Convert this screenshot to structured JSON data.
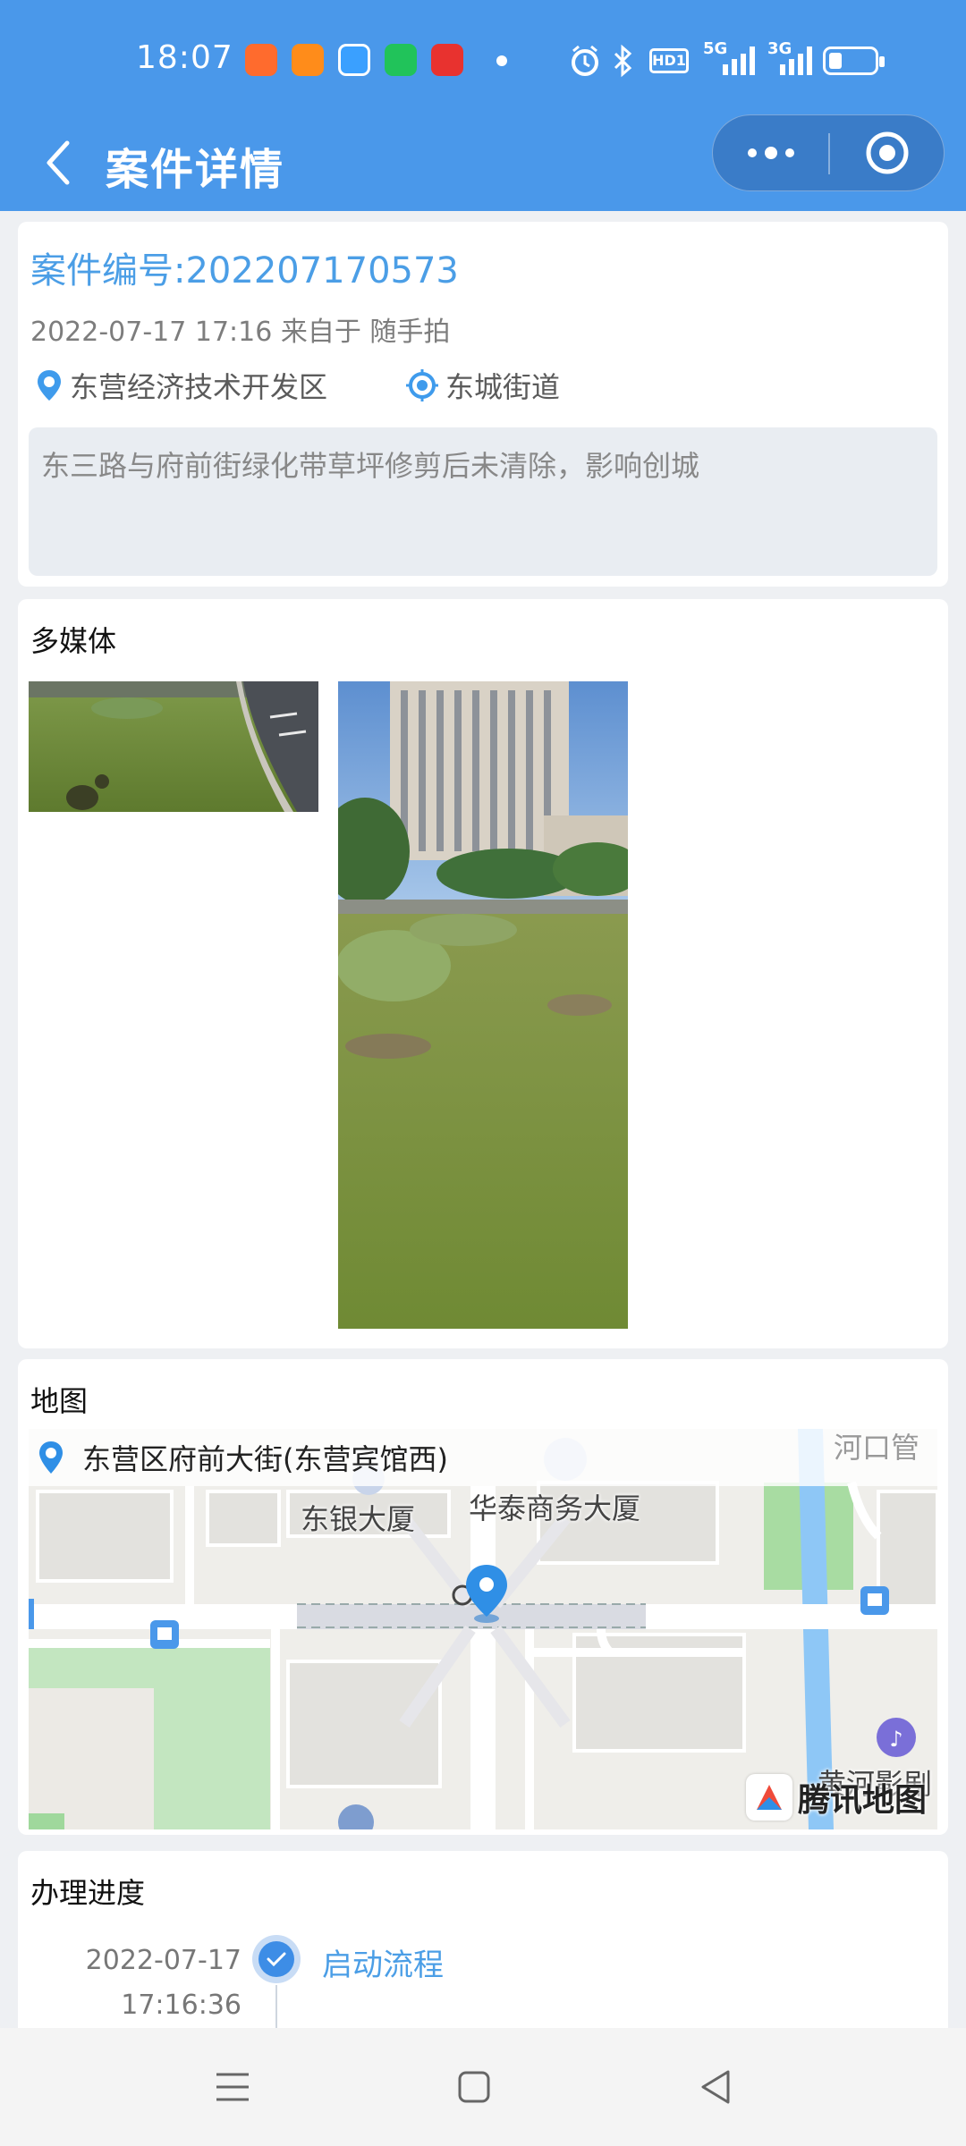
{
  "status_bar": {
    "time": "18:07",
    "indicators": [
      "alarm-icon",
      "bluetooth-icon",
      "HD1",
      "5G",
      "3G",
      "battery-icon"
    ],
    "hd_label": "HD1",
    "net1_label": "5G",
    "net2_label": "3G"
  },
  "nav": {
    "title": "案件详情",
    "back_icon": "chevron-left-icon",
    "more_icon": "more-dots-icon",
    "close_icon": "target-icon"
  },
  "case": {
    "number": "案件编号:202207170573",
    "meta": "2022-07-17 17:16 来自于 随手拍",
    "district": "东营经济技术开发区",
    "street": "东城街道",
    "description": "东三路与府前街绿化带草坪修剪后未清除，影响创城"
  },
  "media": {
    "title": "多媒体"
  },
  "map": {
    "title": "地图",
    "address": "东营区府前大街(东营宾馆西)",
    "labels": [
      "东银大厦",
      "华泰商务大厦",
      "河口管",
      "黄河影剧"
    ],
    "brand": "腾讯地图"
  },
  "progress": {
    "title": "办理进度",
    "steps": [
      {
        "date": "2022-07-17",
        "time": "17:16:36",
        "label": "启动流程"
      }
    ]
  },
  "colors": {
    "primary": "#4a98ea",
    "accent_text": "#4b9ee6"
  }
}
